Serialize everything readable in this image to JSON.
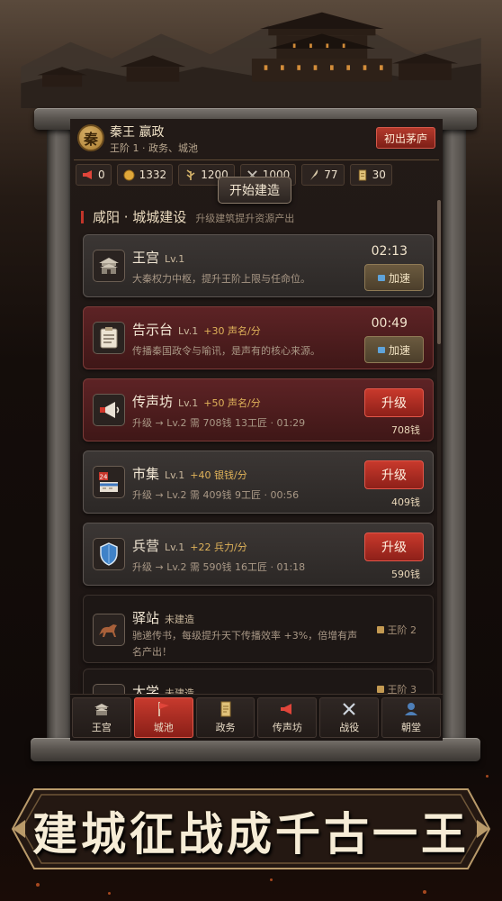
{
  "player": {
    "seal_char": "秦",
    "name": "秦王 嬴政",
    "subtitle": "王阶 1 · 政务、城池",
    "exit_label": "初出茅庐"
  },
  "resources": [
    {
      "icon": "horn-icon",
      "value": "0",
      "color": "#e0453a"
    },
    {
      "icon": "coin-icon",
      "value": "1332",
      "color": "#e0a83a"
    },
    {
      "icon": "grain-icon",
      "value": "1200",
      "color": "#d6b46a"
    },
    {
      "icon": "swords-icon",
      "value": "1000",
      "color": "#c8c2b8"
    },
    {
      "icon": "feather-icon",
      "value": "77",
      "color": "#d6c8a8"
    },
    {
      "icon": "scroll-icon",
      "value": "30",
      "color": "#e0c27a"
    }
  ],
  "tooltip": "开始建造",
  "section": {
    "title": "咸阳 · 城城建设",
    "subtitle": "升级建筑提升资源产出"
  },
  "buildings": [
    {
      "name": "王宫",
      "level": "Lv.1",
      "bonus": "",
      "desc": "大秦权力中枢，提升王阶上限与任命位。",
      "timer": "02:13",
      "action": "加速",
      "type": "building",
      "icon": "palace-icon"
    },
    {
      "name": "告示台",
      "level": "Lv.1",
      "bonus": "+30 声名/分",
      "desc": "传播秦国政令与喻讯，是声有的核心来源。",
      "timer": "00:49",
      "action": "加速",
      "type": "building",
      "icon": "notice-board-icon"
    },
    {
      "name": "传声坊",
      "level": "Lv.1",
      "bonus": "+50 声名/分",
      "desc": "升级 → Lv.2  需 708钱 13工匠 · 01:29",
      "action": "升级",
      "cost": "708钱",
      "type": "upgrade",
      "icon": "megaphone-icon"
    },
    {
      "name": "市集",
      "level": "Lv.1",
      "bonus": "+40 银钱/分",
      "desc": "升级 → Lv.2  需 409钱 9工匠 · 00:56",
      "action": "升级",
      "cost": "409钱",
      "type": "upgrade",
      "icon": "market-icon"
    },
    {
      "name": "兵营",
      "level": "Lv.1",
      "bonus": "+22 兵力/分",
      "desc": "升级 → Lv.2  需 590钱 16工匠 · 01:18",
      "action": "升级",
      "cost": "590钱",
      "type": "upgrade",
      "icon": "shield-icon"
    },
    {
      "name": "驿站",
      "tag": "未建造",
      "desc1": "驰递传书，每级提升天下传播效率 +3%，倍增有声",
      "desc2": "名产出！",
      "lock": "王阶 2",
      "type": "locked",
      "icon": "horse-icon"
    },
    {
      "name": "太学",
      "tag": "未建造",
      "lock": "王阶 3",
      "type": "locked",
      "icon": "book-icon"
    }
  ],
  "nav": [
    {
      "label": "王宫",
      "icon": "palace-icon",
      "active": false
    },
    {
      "label": "城池",
      "icon": "flag-icon",
      "active": true
    },
    {
      "label": "政务",
      "icon": "scroll-icon",
      "active": false
    },
    {
      "label": "传声坊",
      "icon": "megaphone-icon",
      "active": false
    },
    {
      "label": "战役",
      "icon": "swords-icon",
      "active": false
    },
    {
      "label": "朝堂",
      "icon": "court-icon",
      "active": false
    }
  ],
  "banner": "建城征战成千古一王"
}
